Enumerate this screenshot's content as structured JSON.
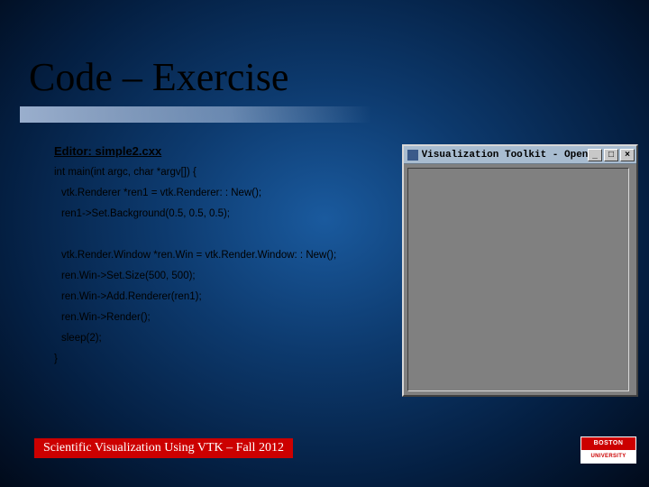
{
  "title": "Code – Exercise",
  "editor_label": "Editor:  simple2.cxx",
  "code": {
    "l0": "int main(int argc, char *argv[]) {",
    "l1": "vtk.Renderer *ren1 = vtk.Renderer: : New();",
    "l2": "ren1->Set.Background(0.5, 0.5, 0.5);",
    "l3": "vtk.Render.Window *ren.Win = vtk.Render.Window: : New();",
    "l4": "ren.Win->Set.Size(500, 500);",
    "l5": "ren.Win->Add.Renderer(ren1);",
    "l6": "ren.Win->Render();",
    "l7": "sleep(2);",
    "l8": "}"
  },
  "vtk_window": {
    "title": "Visualization Toolkit - OpenG",
    "min": "_",
    "max": "□",
    "close": "×"
  },
  "footer": "Scientific Visualization Using VTK – Fall 2012",
  "logo": {
    "top": "BOSTON",
    "bottom": "UNIVERSITY"
  }
}
